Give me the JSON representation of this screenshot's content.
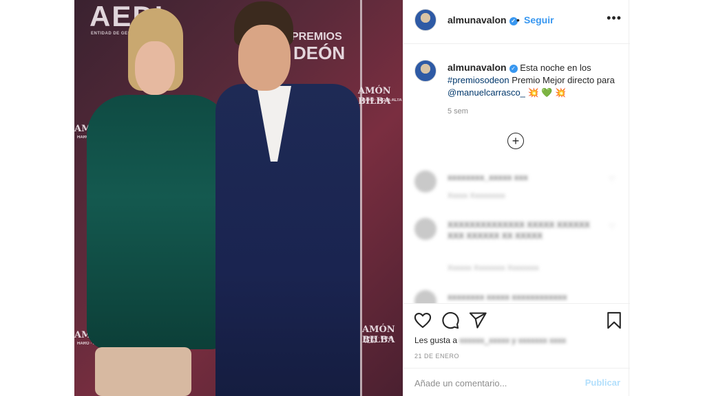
{
  "post": {
    "username": "almunavalon",
    "verified_mark": "✓",
    "dot": "•",
    "follow_label": "Seguir",
    "more_label": "•••"
  },
  "caption": {
    "username": "almunavalon",
    "text_1": "Esta noche en los",
    "hashtag": "#premiosodeon",
    "text_2": "Premio Mejor directo para",
    "mention": "@manuelcarrasco_",
    "emoji_boom": "💥",
    "emoji_heart": "💚",
    "time": "5 sem"
  },
  "load_more_label": "+",
  "blurred_comments": [
    {
      "text": "xxxxxxxx_xxxxx xxx",
      "meta": "Xxxxx  Xxxxxxxxx"
    },
    {
      "text": "XXXXXXXXXXXXXX XXXXX XXXXXX XXX XXXXXX XX XXXXX",
      "meta": "Xxxxxx  Xxxxxxxx Xxxxxxxx"
    },
    {
      "text": "xxxxxxxx xxxxx xxxxxxxxxxxx",
      "meta": ""
    }
  ],
  "likes": {
    "prefix": "Les gusta a",
    "names": "xxxxxx_xxxxx y xxxxxxx xxxx"
  },
  "date": "21 DE ENERO",
  "compose": {
    "placeholder": "Añade un comentario...",
    "publish_label": "Publicar"
  },
  "photo_backdrop": {
    "aedi": "AEDI",
    "aedi_sub": "ENTIDAD DE GESTIÓN DE ...",
    "premios": "PREMIOS",
    "odeon": "DEÓN",
    "ramon": "AMÓN BILBA",
    "ramon_sub": "HARO · RIOJA ALTA"
  },
  "icons": {
    "like": "heart-outline-icon",
    "comment": "comment-bubble-icon",
    "share": "paper-plane-icon",
    "save": "bookmark-icon"
  },
  "colors": {
    "accent": "#3897f0",
    "link": "#00376b",
    "publish_disabled": "#b2dffc"
  }
}
